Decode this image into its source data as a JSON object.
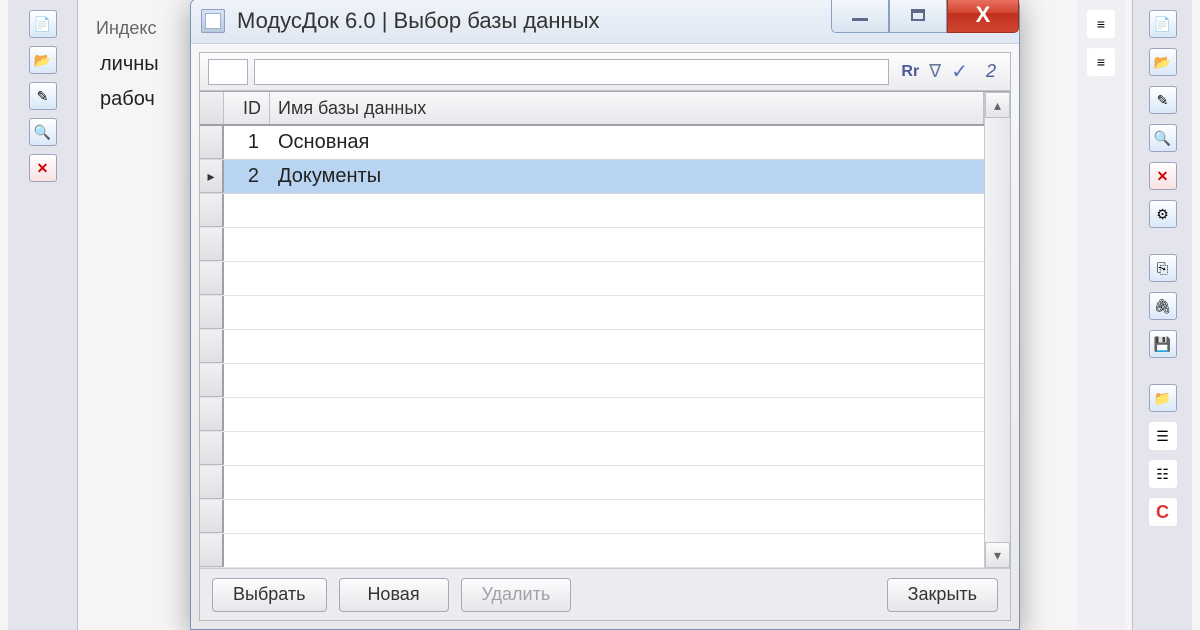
{
  "background": {
    "tab_header": "Индекс",
    "tree_items": [
      "личны",
      "рабоч"
    ]
  },
  "dialog": {
    "title": "МодусДок 6.0 | Выбор базы данных",
    "filter": {
      "case_label": "Rr",
      "count": "2"
    },
    "grid": {
      "headers": {
        "id": "ID",
        "name": "Имя базы данных"
      },
      "rows": [
        {
          "id": "1",
          "name": "Основная",
          "selected": false
        },
        {
          "id": "2",
          "name": "Документы",
          "selected": true
        }
      ]
    },
    "buttons": {
      "select": "Выбрать",
      "new": "Новая",
      "delete": "Удалить",
      "close": "Закрыть"
    }
  }
}
